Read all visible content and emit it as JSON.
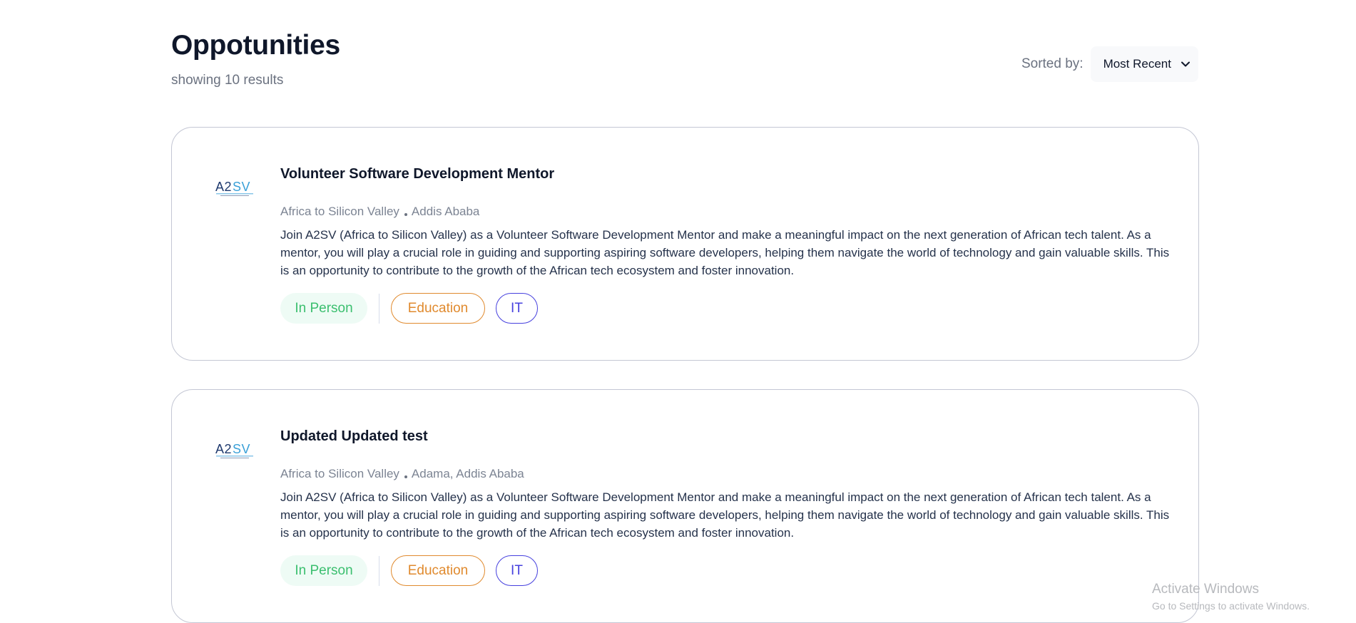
{
  "header": {
    "title": "Oppotunities",
    "results": "showing 10 results",
    "sort_label": "Sorted by:",
    "sort_value": "Most Recent"
  },
  "cards": [
    {
      "logo_text": "A2SV",
      "title": "Volunteer Software Development Mentor",
      "org": "Africa to Silicon Valley",
      "location": "Addis Ababa",
      "description": "Join A2SV (Africa to Silicon Valley) as a Volunteer Software Development Mentor and make a meaningful impact on the next generation of African tech talent. As a mentor, you will play a crucial role in guiding and supporting aspiring software developers, helping them navigate the world of technology and gain valuable skills. This is an opportunity to contribute to the growth of the African tech ecosystem and foster innovation.",
      "mode": "In Person",
      "categories": [
        "Education",
        "IT"
      ]
    },
    {
      "logo_text": "A2SV",
      "title": "Updated Updated test",
      "org": "Africa to Silicon Valley",
      "location": "Adama, Addis Ababa",
      "description": "Join A2SV (Africa to Silicon Valley) as a Volunteer Software Development Mentor and make a meaningful impact on the next generation of African tech talent. As a mentor, you will play a crucial role in guiding and supporting aspiring software developers, helping them navigate the world of technology and gain valuable skills. This is an opportunity to contribute to the growth of the African tech ecosystem and foster innovation.",
      "mode": "In Person",
      "categories": [
        "Education",
        "IT"
      ]
    }
  ],
  "watermark": {
    "title": "Activate Windows",
    "subtitle": "Go to Settings to activate Windows."
  },
  "colors": {
    "mode_tag": "#3bbf6f",
    "education_tag": "#e08a2e",
    "it_tag": "#4640de",
    "logo_blue": "#3aa0d8",
    "logo_dark": "#1f3a6e"
  }
}
